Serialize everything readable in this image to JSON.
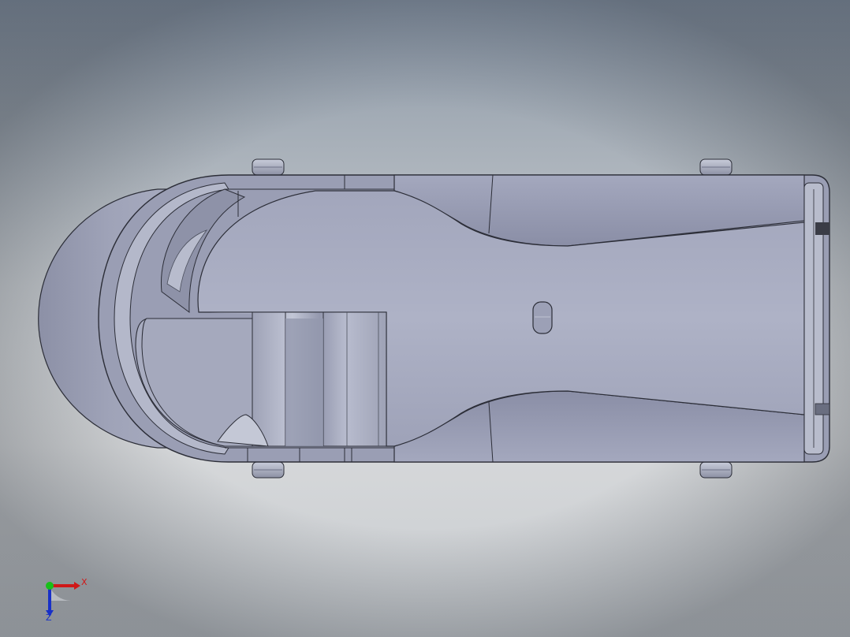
{
  "viewport": {
    "triad": {
      "x_label": "X",
      "z_label": "Z",
      "colors": {
        "x": "#d01818",
        "y": "#18c018",
        "z": "#1830c8"
      }
    }
  },
  "colors": {
    "part_fill": "#a9adc2",
    "part_dark": "#8a8ea4",
    "part_light": "#bcc0d2",
    "edge": "#2c2e38"
  }
}
